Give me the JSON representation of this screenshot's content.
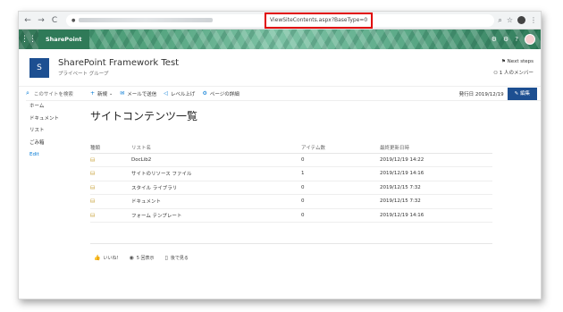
{
  "browser": {
    "url_visible": "ViewSiteContents.aspx?BaseType=0",
    "back": "←",
    "forward": "→",
    "reload": "C",
    "lock": "🔒"
  },
  "suite": {
    "title": "SharePoint"
  },
  "site": {
    "logo_letter": "S",
    "title": "SharePoint Framework Test",
    "subtitle": "プライベート グループ",
    "next_steps": "Next steps",
    "members": "1 人のメンバー"
  },
  "leftnav": {
    "search_placeholder": "このサイトを検索",
    "items": [
      "ホーム",
      "ドキュメント",
      "リスト",
      "ごみ箱",
      "Edit"
    ]
  },
  "commandbar": {
    "new": "新規",
    "email": "メールで送信",
    "promote": "レベル上げ",
    "page_details": "ページの詳細",
    "published": "発行日 2019/12/19",
    "edit": "編集"
  },
  "page": {
    "title": "サイトコンテンツ一覧"
  },
  "table": {
    "headers": [
      "種類",
      "リスト名",
      "アイテム数",
      "最終更新日時"
    ],
    "rows": [
      {
        "name": "DocLib2",
        "count": "0",
        "modified": "2019/12/19 14:22"
      },
      {
        "name": "サイトのリソース ファイル",
        "count": "1",
        "modified": "2019/12/19 14:16"
      },
      {
        "name": "スタイル ライブラリ",
        "count": "0",
        "modified": "2019/12/15 7:32"
      },
      {
        "name": "ドキュメント",
        "count": "0",
        "modified": "2019/12/15 7:32"
      },
      {
        "name": "フォーム テンプレート",
        "count": "0",
        "modified": "2019/12/19 14:16"
      }
    ]
  },
  "social": {
    "like": "いいね!",
    "views": "5 回表示",
    "save": "後で見る"
  },
  "colors": {
    "suite_green": "#2f7a58",
    "brand_blue": "#1d4f91",
    "accent": "#0078d4",
    "highlight": "#e00000"
  }
}
